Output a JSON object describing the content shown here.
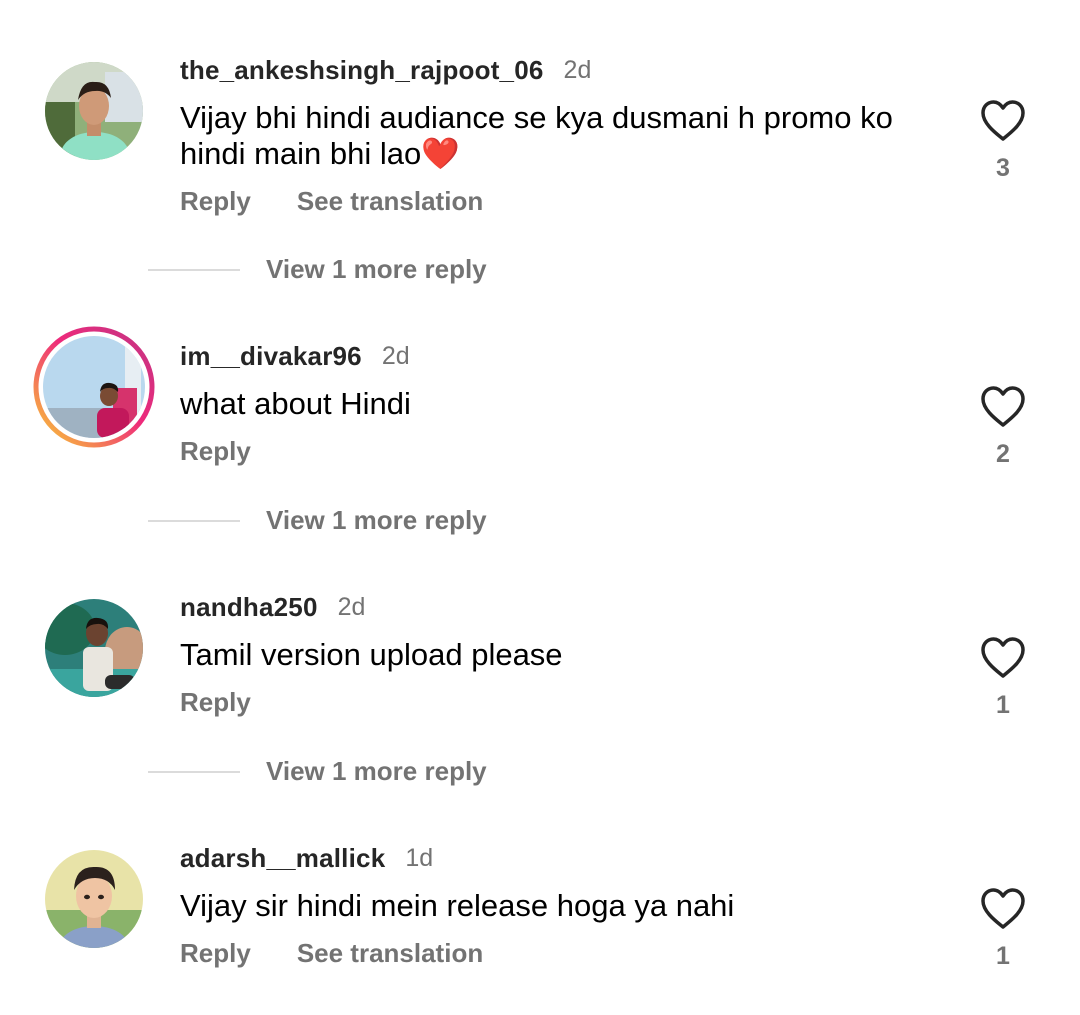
{
  "comments": [
    {
      "username": "the_ankeshsingh_rajpoot_06",
      "time": "2d",
      "text": "Vijay bhi hindi audiance se kya dusmani h promo ko hindi main bhi lao",
      "emoji": "❤️",
      "likes": "3",
      "reply_label": "Reply",
      "translate_label": "See translation",
      "view_replies": "View 1 more reply"
    },
    {
      "username": "im__divakar96",
      "time": "2d",
      "text": "what about Hindi",
      "likes": "2",
      "reply_label": "Reply",
      "view_replies": "View 1 more reply"
    },
    {
      "username": "nandha250",
      "time": "2d",
      "text": "Tamil version upload please",
      "likes": "1",
      "reply_label": "Reply",
      "view_replies": "View 1 more reply"
    },
    {
      "username": "adarsh__mallick",
      "time": "1d",
      "text": "Vijay sir hindi mein release hoga ya nahi",
      "likes": "1",
      "reply_label": "Reply",
      "translate_label": "See translation"
    }
  ],
  "colors": {
    "secondary_text": "#737373",
    "username": "#262626",
    "divider": "#dbdbdb",
    "heart_outline": "#262626",
    "story_ring_start": "#f9ce34",
    "story_ring_mid": "#ee2a7b",
    "story_ring_end": "#6228d7"
  },
  "icons": {
    "like": "heart-outline-icon"
  }
}
